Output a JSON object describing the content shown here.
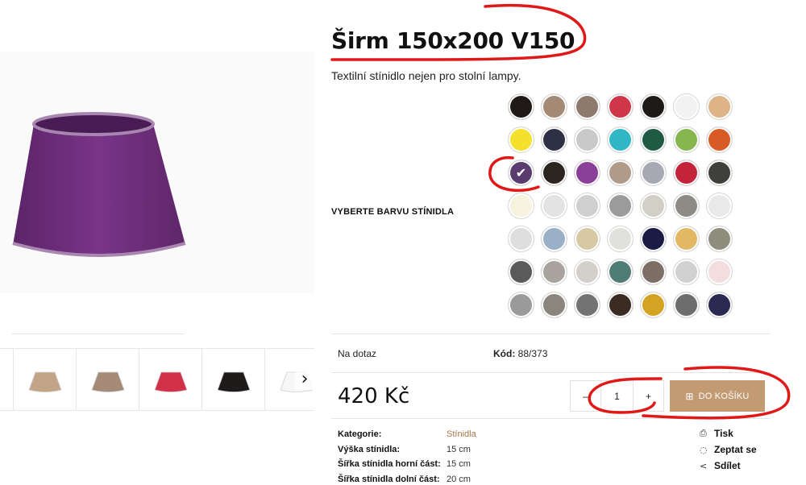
{
  "product": {
    "title": "Širm 150x200 V150",
    "subtitle": "Textilní stínidlo nejen pro stolní lampy.",
    "color_label": "VYBERTE BARVU STÍNIDLA",
    "main_color": "#6e2d7c",
    "availability": "Na dotaz",
    "code_label": "Kód:",
    "code_value": "88/373",
    "price": "420 Kč",
    "quantity": "1",
    "qty_minus": "–",
    "qty_plus": "+",
    "cart_button": "DO KOŠÍKU",
    "cart_color": "#c39b73"
  },
  "swatches": [
    "#1f1a18",
    "#a48a74",
    "#8d7a6c",
    "#d0364a",
    "#1d1a18",
    "#f2f2f2",
    "#ddb488",
    "#f4e12d",
    "#2e3146",
    "#c9c9c9",
    "#2fb7c6",
    "#1f5a45",
    "#87b54f",
    "#d85a25",
    "#5a3d6e",
    "#2b2520",
    "#8a3f98",
    "#b09a8a",
    "#a6a9b3",
    "#c4243a",
    "#3f403c",
    "#f6f3de",
    "#e3e3e3",
    "#cfcfcf",
    "#9b9b9b",
    "#d2cfc6",
    "#8e8a85",
    "#e9e9e9",
    "#dedede",
    "#9ab0c6",
    "#d8c9a5",
    "#e0e0dc",
    "#1a1c45",
    "#e2b865",
    "#8f8d7d",
    "#5a5a5a",
    "#a8a39d",
    "#d3d0cc",
    "#4f7c74",
    "#7d6f66",
    "#d1d1d1",
    "#f3dedf",
    "#9a9a9a",
    "#8a857d",
    "#737373",
    "#3a2b23",
    "#d5a323",
    "#6d6d6d",
    "#2b2a52"
  ],
  "thumbs": [
    {
      "color": "#c2a587"
    },
    {
      "color": "#a58a78"
    },
    {
      "color": "#d1324a"
    },
    {
      "color": "#1f1b1a"
    },
    {
      "color": "#f7f7f7"
    }
  ],
  "specs": [
    {
      "k": "Kategorie:",
      "v": "Stínidla",
      "link": true
    },
    {
      "k": "Výška stínidla:",
      "v": "15 cm",
      "link": false
    },
    {
      "k": "Šířka stínidla horní část:",
      "v": "15 cm",
      "link": false
    },
    {
      "k": "Šířka stínidla dolní část:",
      "v": "20 cm",
      "link": false
    }
  ],
  "actions": [
    {
      "icon": "printer-icon",
      "glyph": "⎙",
      "label": "Tisk"
    },
    {
      "icon": "chat-icon",
      "glyph": "◌",
      "label": "Zeptat se"
    },
    {
      "icon": "share-icon",
      "glyph": "<",
      "label": "Sdílet"
    }
  ],
  "annotation_color": "#e01818"
}
